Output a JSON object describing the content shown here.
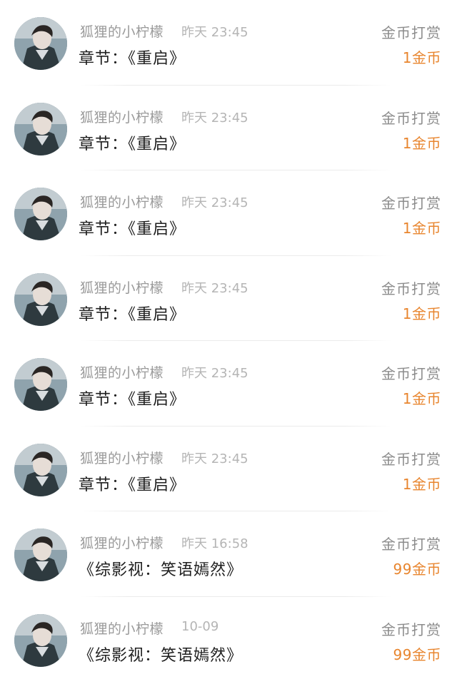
{
  "records": [
    {
      "user": "狐狸的小柠檬",
      "time": "昨天 23:45",
      "title": "章节：《重启》",
      "type": "金币打赏",
      "amount": "1金币"
    },
    {
      "user": "狐狸的小柠檬",
      "time": "昨天 23:45",
      "title": "章节：《重启》",
      "type": "金币打赏",
      "amount": "1金币"
    },
    {
      "user": "狐狸的小柠檬",
      "time": "昨天 23:45",
      "title": "章节：《重启》",
      "type": "金币打赏",
      "amount": "1金币"
    },
    {
      "user": "狐狸的小柠檬",
      "time": "昨天 23:45",
      "title": "章节：《重启》",
      "type": "金币打赏",
      "amount": "1金币"
    },
    {
      "user": "狐狸的小柠檬",
      "time": "昨天 23:45",
      "title": "章节：《重启》",
      "type": "金币打赏",
      "amount": "1金币"
    },
    {
      "user": "狐狸的小柠檬",
      "time": "昨天 23:45",
      "title": "章节：《重启》",
      "type": "金币打赏",
      "amount": "1金币"
    },
    {
      "user": "狐狸的小柠檬",
      "time": "昨天 16:58",
      "title": "《综影视：笑语嫣然》",
      "type": "金币打赏",
      "amount": "99金币"
    },
    {
      "user": "狐狸的小柠檬",
      "time": "10-09",
      "title": "《综影视：笑语嫣然》",
      "type": "金币打赏",
      "amount": "99金币"
    }
  ],
  "colors": {
    "amount": "#e8852e",
    "username": "#9a9a9a",
    "time": "#b5b5b5",
    "title": "#1f1f1f"
  },
  "icons": {
    "avatar": "user-avatar-photo"
  }
}
